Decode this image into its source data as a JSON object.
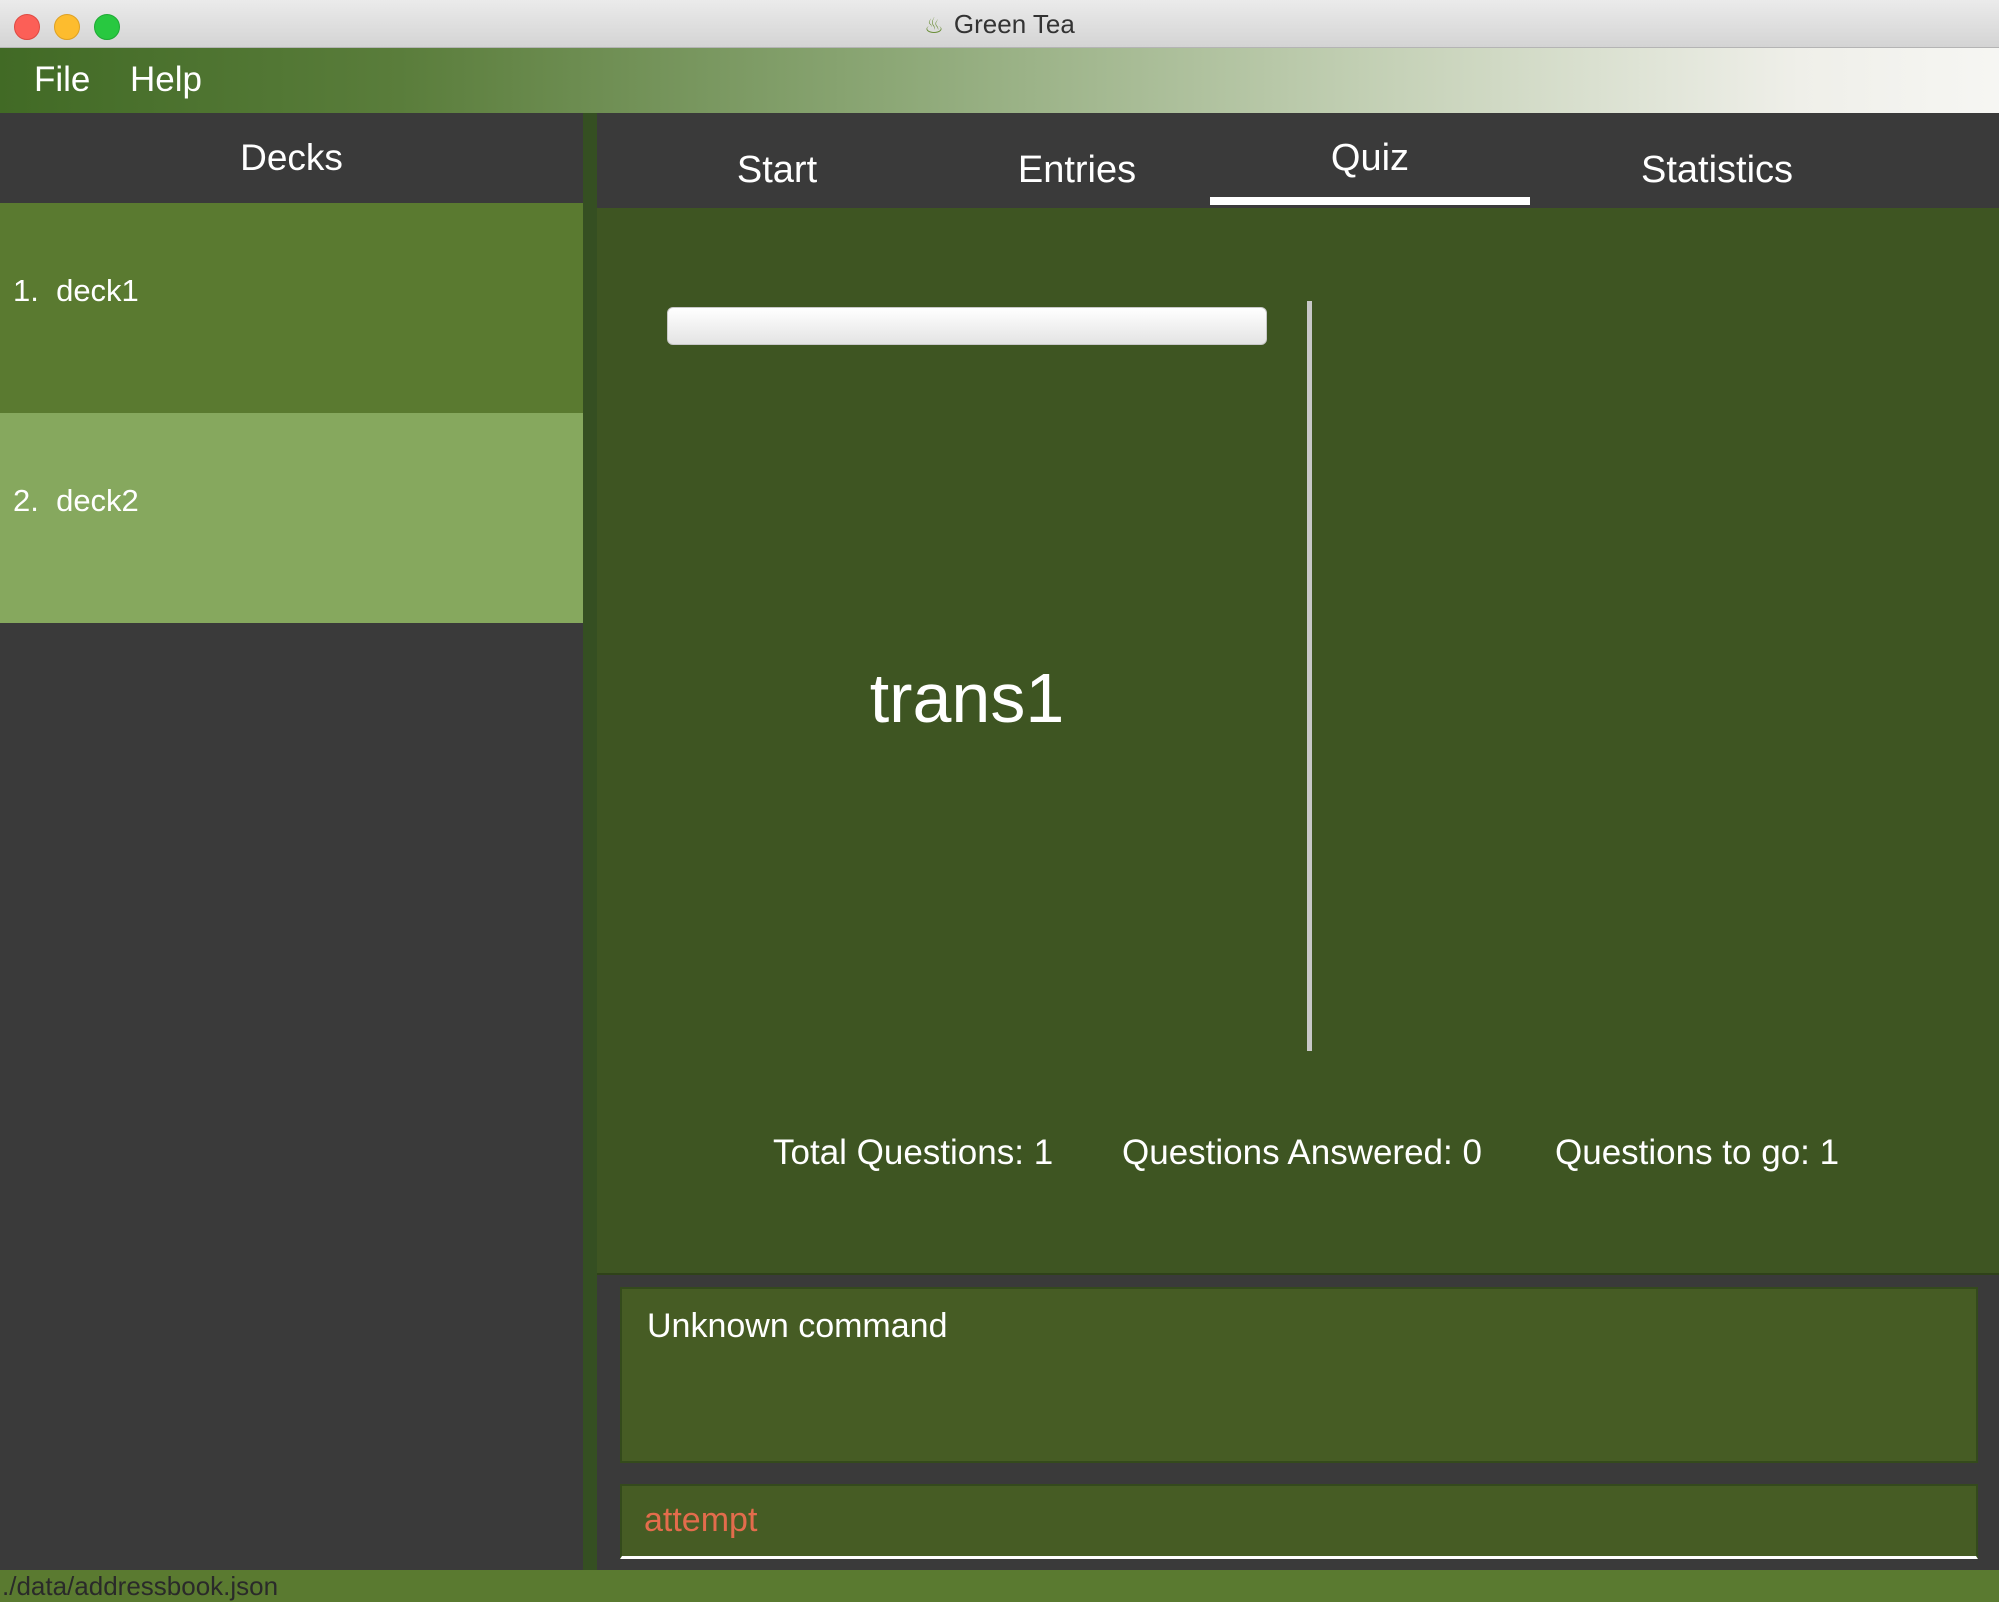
{
  "window": {
    "title": "Green Tea"
  },
  "menu": {
    "items": [
      "File",
      "Help"
    ]
  },
  "sidebar": {
    "header": "Decks",
    "decks": [
      {
        "label": "1.  deck1"
      },
      {
        "label": "2.  deck2"
      }
    ]
  },
  "tabs": {
    "items": [
      "Start",
      "Entries",
      "Quiz",
      "Statistics"
    ],
    "active": "Quiz"
  },
  "quiz": {
    "question": "trans1",
    "progress": 0,
    "total_questions": "Total Questions: 1",
    "questions_answered": "Questions Answered: 0",
    "questions_to_go": "Questions to go: 1"
  },
  "result": {
    "text": "Unknown command"
  },
  "command": {
    "value": "attempt"
  },
  "status": {
    "path": "./data/addressbook.json"
  },
  "colors": {
    "accent_dark": "#3e5522",
    "deck_selected": "#86a85e",
    "deck_normal": "#5a7a30",
    "command_text": "#e36c4c"
  }
}
